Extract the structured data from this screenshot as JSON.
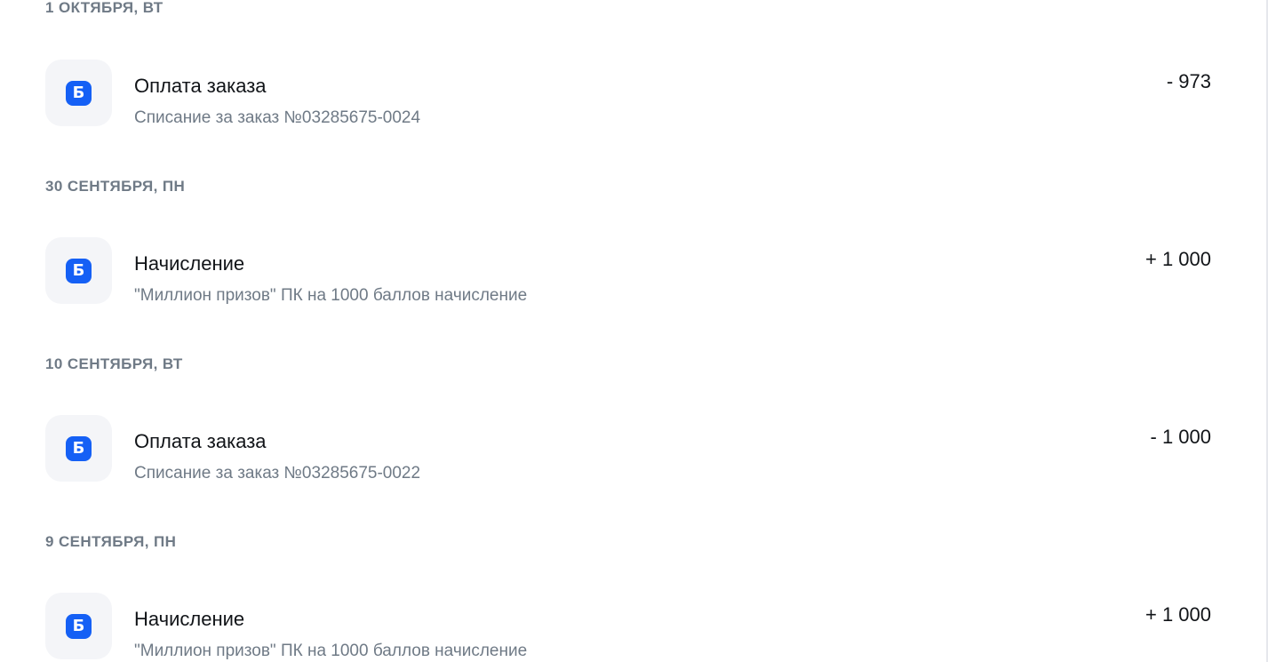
{
  "history": {
    "groups": [
      {
        "date": "1 ОКТЯБРЯ, ВТ",
        "transaction": {
          "icon_letter": "Б",
          "icon_name": "bonus-icon",
          "title": "Оплата заказа",
          "subtitle": "Списание за заказ №03285675-0024",
          "amount": "- 973"
        }
      },
      {
        "date": "30 СЕНТЯБРЯ, ПН",
        "transaction": {
          "icon_letter": "Б",
          "icon_name": "bonus-icon",
          "title": "Начисление",
          "subtitle": "\"Миллион призов\" ПК на 1000 баллов начисление",
          "amount": "+ 1 000"
        }
      },
      {
        "date": "10 СЕНТЯБРЯ, ВТ",
        "transaction": {
          "icon_letter": "Б",
          "icon_name": "bonus-icon",
          "title": "Оплата заказа",
          "subtitle": "Списание за заказ №03285675-0022",
          "amount": "- 1 000"
        }
      },
      {
        "date": "9 СЕНТЯБРЯ, ПН",
        "transaction": {
          "icon_letter": "Б",
          "icon_name": "bonus-icon",
          "title": "Начисление",
          "subtitle": "\"Миллион призов\" ПК на 1000 баллов начисление",
          "amount": "+ 1 000"
        }
      }
    ]
  },
  "colors": {
    "icon_background": "#1560f5",
    "icon_tile": "#f4f5f8",
    "muted_text": "#6f7a86",
    "primary_text": "#111418"
  }
}
